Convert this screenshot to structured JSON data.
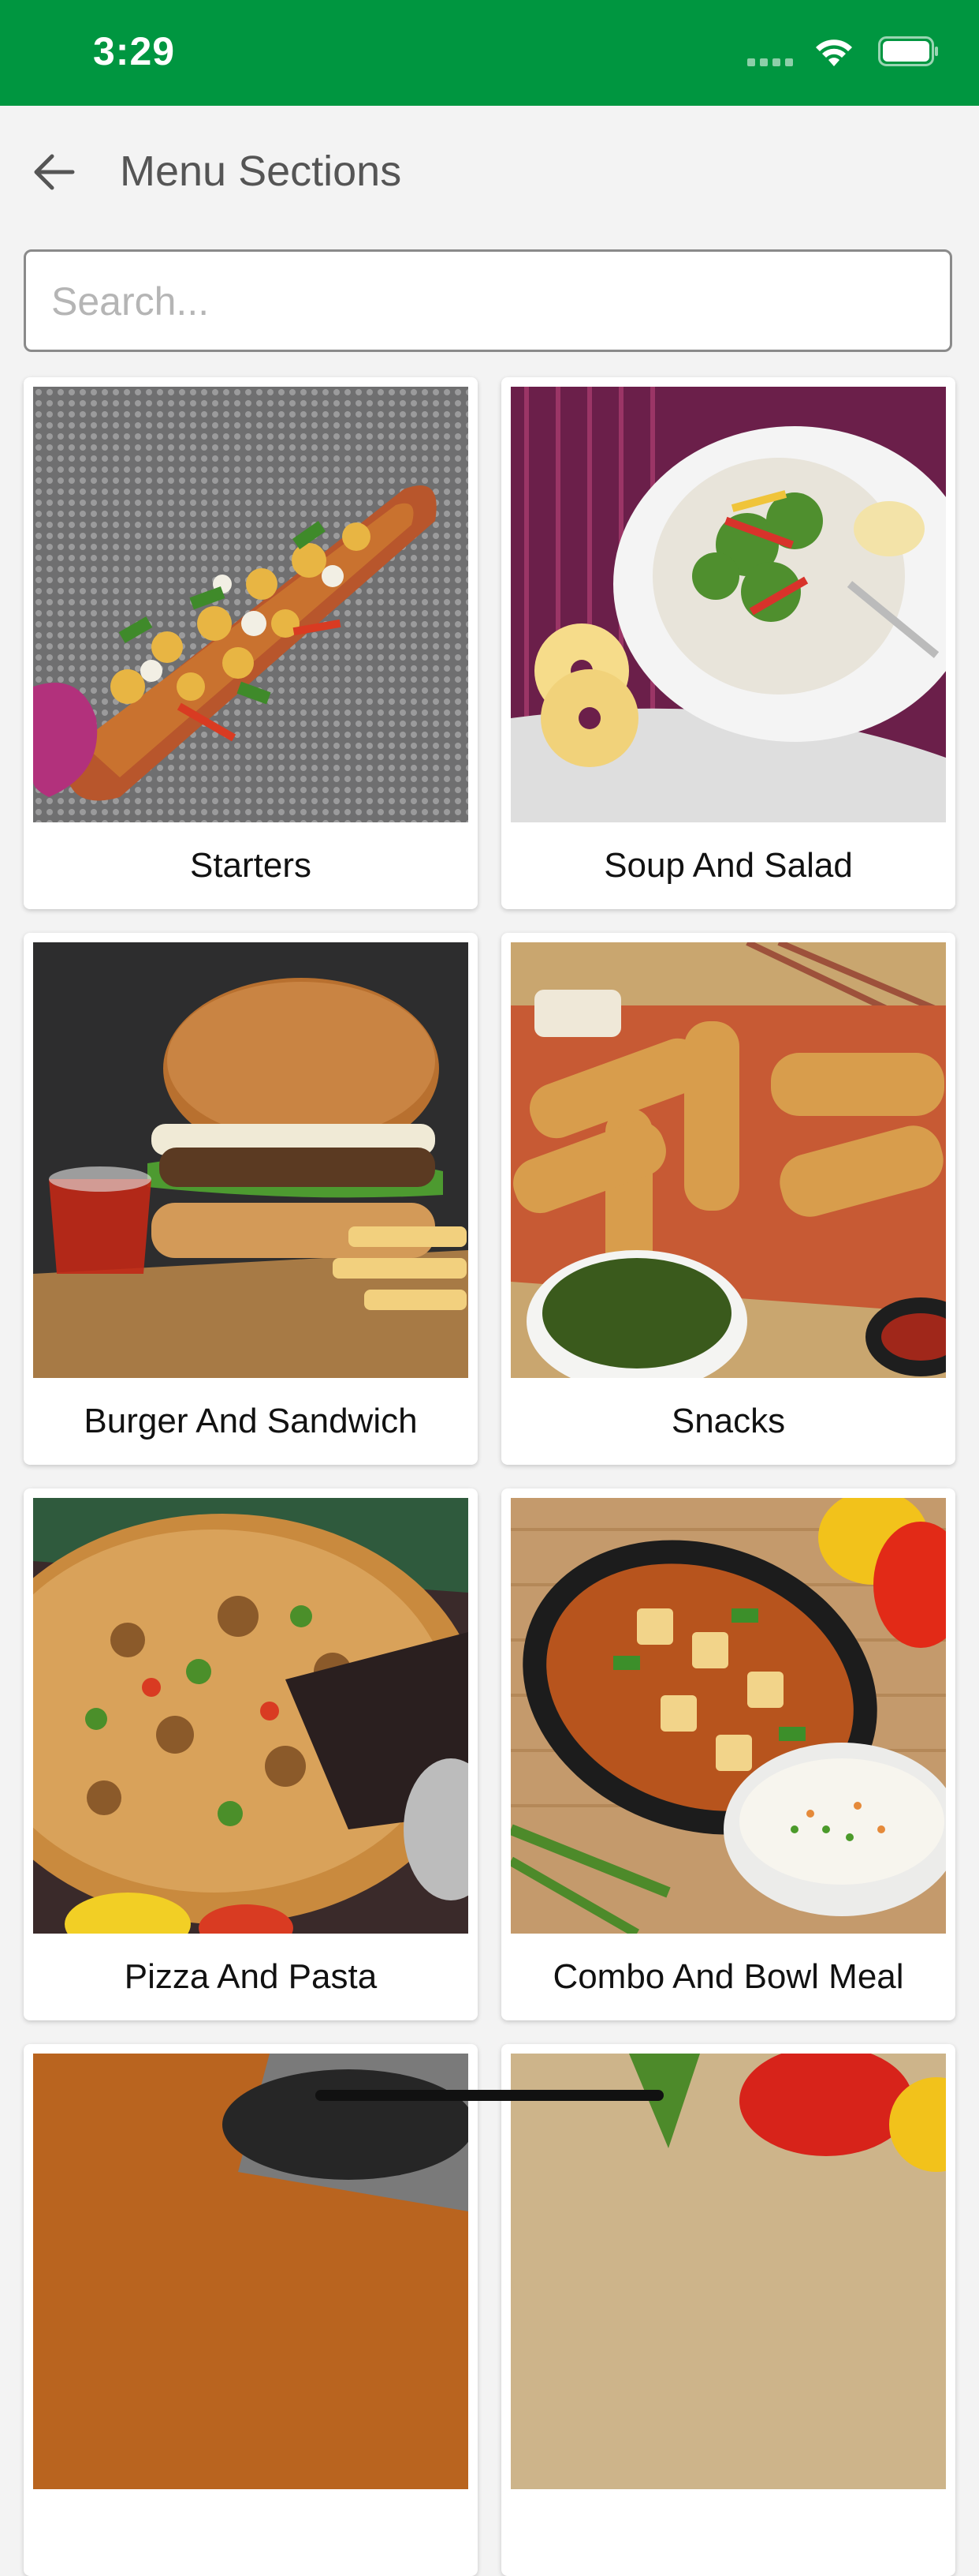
{
  "status_bar": {
    "time": "3:29",
    "signal_icon": "signal-dots-icon",
    "wifi_icon": "wifi-icon",
    "battery_icon": "battery-icon",
    "background": "#009640"
  },
  "header": {
    "back_icon": "arrow-left-icon",
    "title": "Menu Sections"
  },
  "search": {
    "placeholder": "Search...",
    "value": ""
  },
  "sections": [
    {
      "label": "Starters"
    },
    {
      "label": "Soup And Salad"
    },
    {
      "label": "Burger And Sandwich"
    },
    {
      "label": "Snacks"
    },
    {
      "label": "Pizza And Pasta"
    },
    {
      "label": "Combo And Bowl Meal"
    },
    {
      "label": ""
    },
    {
      "label": ""
    }
  ]
}
